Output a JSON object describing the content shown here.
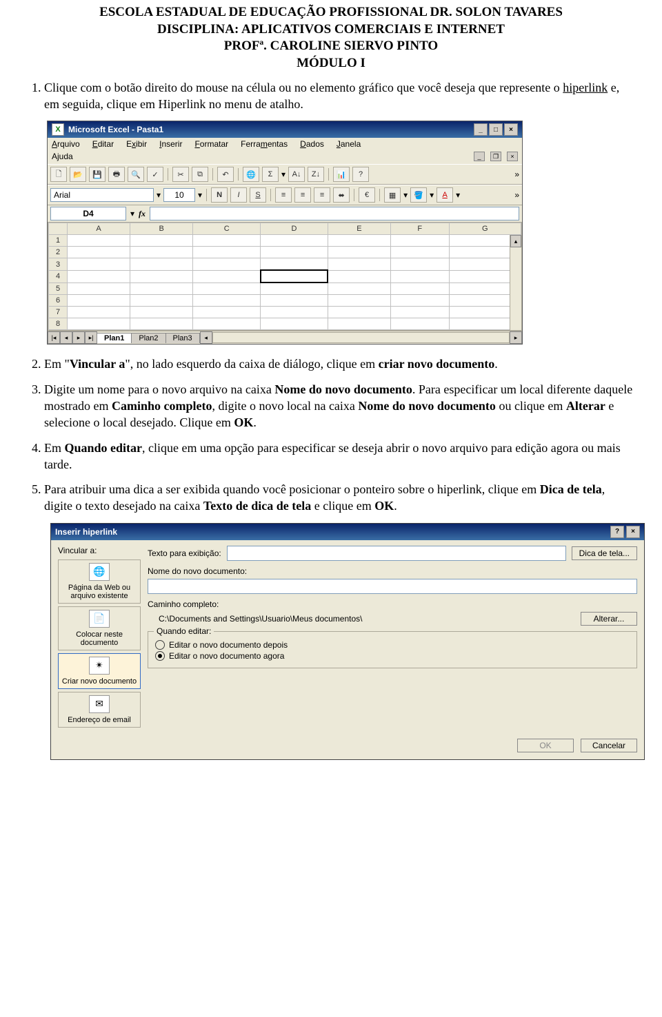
{
  "header": {
    "line1": "ESCOLA ESTADUAL DE EDUCAÇÃO PROFISSIONAL DR. SOLON  TAVARES",
    "line2": "DISCIPLINA: APLICATIVOS COMERCIAIS E INTERNET",
    "line3": "PROFª. CAROLINE SIERVO PINTO",
    "line4": "MÓDULO I"
  },
  "steps": {
    "s1a": "Clique com o botão direito do mouse na célula ou no elemento gráfico que você deseja que represente o ",
    "s1b": "hiperlink",
    "s1c": " e, em seguida, clique em Hiperlink no menu de atalho.",
    "s2a": "Em \"",
    "s2b": "Vincular a",
    "s2c": "\", no lado esquerdo da caixa de diálogo, clique em ",
    "s2d": "criar novo documento",
    "s2e": ".",
    "s3a": "Digite um nome para o novo arquivo na caixa ",
    "s3b": "Nome do novo documento",
    "s3c": ". Para especificar um local diferente daquele mostrado em ",
    "s3d": "Caminho completo",
    "s3e": ", digite o novo local na caixa ",
    "s3f": "Nome do novo documento",
    "s3g": " ou clique em ",
    "s3h": "Alterar",
    "s3i": " e selecione o local desejado. Clique em ",
    "s3j": "OK",
    "s3k": ".",
    "s4a": "Em ",
    "s4b": "Quando editar",
    "s4c": ", clique em uma opção para especificar se deseja abrir o novo arquivo para edição agora ou mais tarde.",
    "s5a": "Para atribuir uma dica a ser exibida quando você posicionar o ponteiro sobre o hiperlink, clique em ",
    "s5b": "Dica de tela",
    "s5c": ", digite o texto desejado na caixa ",
    "s5d": "Texto de dica de tela",
    "s5e": " e clique em ",
    "s5f": "OK",
    "s5g": "."
  },
  "excel": {
    "title": "Microsoft Excel - Pasta1",
    "menu": {
      "arquivo": "Arquivo",
      "editar": "Editar",
      "exibir": "Exibir",
      "inserir": "Inserir",
      "formatar": "Formatar",
      "ferramentas": "Ferramentas",
      "dados": "Dados",
      "janela": "Janela",
      "ajuda": "Ajuda"
    },
    "font": "Arial",
    "size": "10",
    "namebox": "D4",
    "fx": "fx",
    "cols": [
      "A",
      "B",
      "C",
      "D",
      "E",
      "F",
      "G"
    ],
    "rows": [
      "1",
      "2",
      "3",
      "4",
      "5",
      "6",
      "7",
      "8"
    ],
    "selected": "D4",
    "tabs": [
      "Plan1",
      "Plan2",
      "Plan3"
    ]
  },
  "dlg": {
    "title": "Inserir hiperlink",
    "vincular": "Vincular a:",
    "opts": {
      "web": "Página da Web ou arquivo existente",
      "place": "Colocar neste documento",
      "new": "Criar novo documento",
      "email": "Endereço de email"
    },
    "texto_lbl": "Texto para exibição:",
    "texto_val": "",
    "dica_btn": "Dica de tela...",
    "nome_lbl": "Nome do novo documento:",
    "nome_val": "",
    "caminho_lbl": "Caminho completo:",
    "caminho_val": "C:\\Documents and Settings\\Usuario\\Meus documentos\\",
    "alterar_btn": "Alterar...",
    "quando_lbl": "Quando editar:",
    "r1": "Editar o novo documento depois",
    "r2": "Editar o novo documento agora",
    "ok": "OK",
    "cancel": "Cancelar"
  }
}
